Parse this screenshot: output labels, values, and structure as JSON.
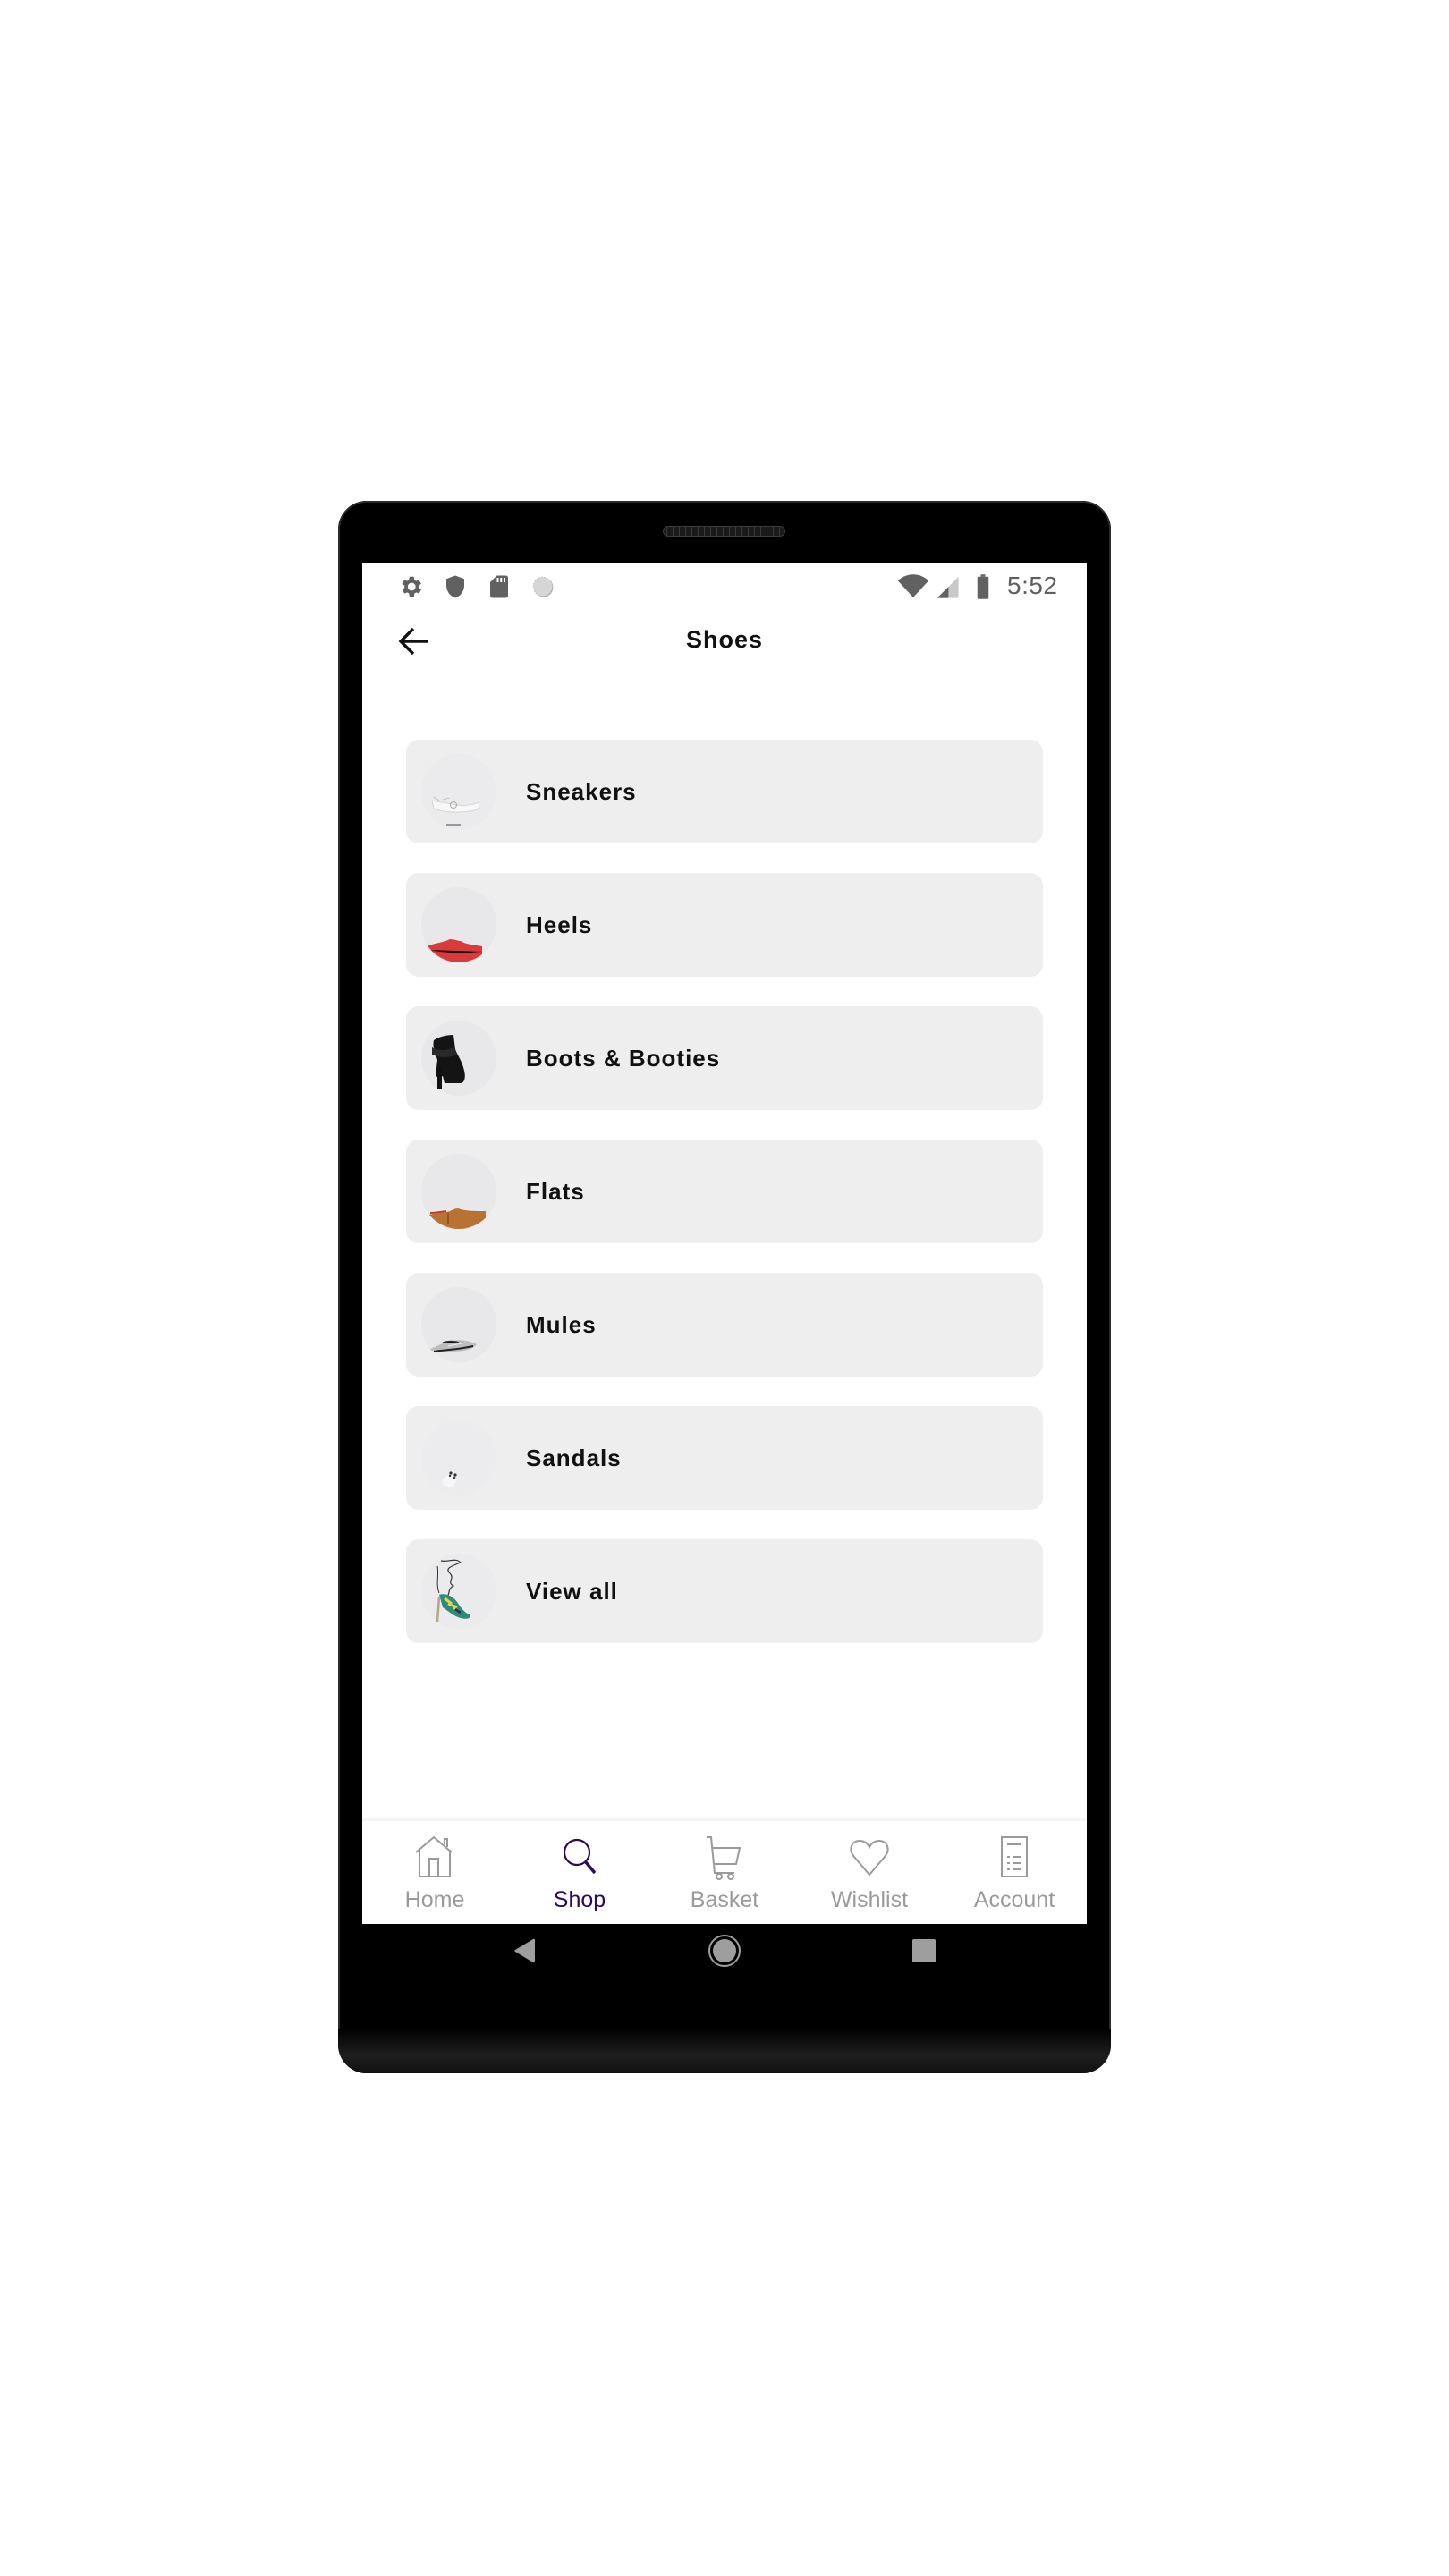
{
  "status_bar": {
    "left_icons": [
      "gear-icon",
      "shield-icon",
      "sd-card-icon",
      "sync-circle-icon"
    ],
    "right_icons": [
      "wifi-icon",
      "cell-signal-icon",
      "battery-icon"
    ],
    "time": "5:52"
  },
  "header": {
    "back_icon": "arrow-left-icon",
    "title": "Shoes"
  },
  "categories": [
    {
      "label": "Sneakers",
      "thumb": "white sneaker"
    },
    {
      "label": "Heels",
      "thumb": "red heel"
    },
    {
      "label": "Boots & Booties",
      "thumb": "black ankle boot"
    },
    {
      "label": "Flats",
      "thumb": "tan flat"
    },
    {
      "label": "Mules",
      "thumb": "silver mule"
    },
    {
      "label": "Sandals",
      "thumb": "white sandal"
    },
    {
      "label": "View all",
      "thumb": "patterned lace-up heel"
    }
  ],
  "bottom_nav": {
    "active_color": "#2b0a57",
    "inactive_color": "#9a9a9a",
    "tabs": [
      {
        "label": "Home",
        "icon": "home-icon",
        "active": false
      },
      {
        "label": "Shop",
        "icon": "search-icon",
        "active": true
      },
      {
        "label": "Basket",
        "icon": "cart-icon",
        "active": false
      },
      {
        "label": "Wishlist",
        "icon": "heart-icon",
        "active": false
      },
      {
        "label": "Account",
        "icon": "account-list-icon",
        "active": false
      }
    ]
  },
  "system_nav": [
    "back-triangle-icon",
    "home-circle-icon",
    "recents-square-icon"
  ]
}
